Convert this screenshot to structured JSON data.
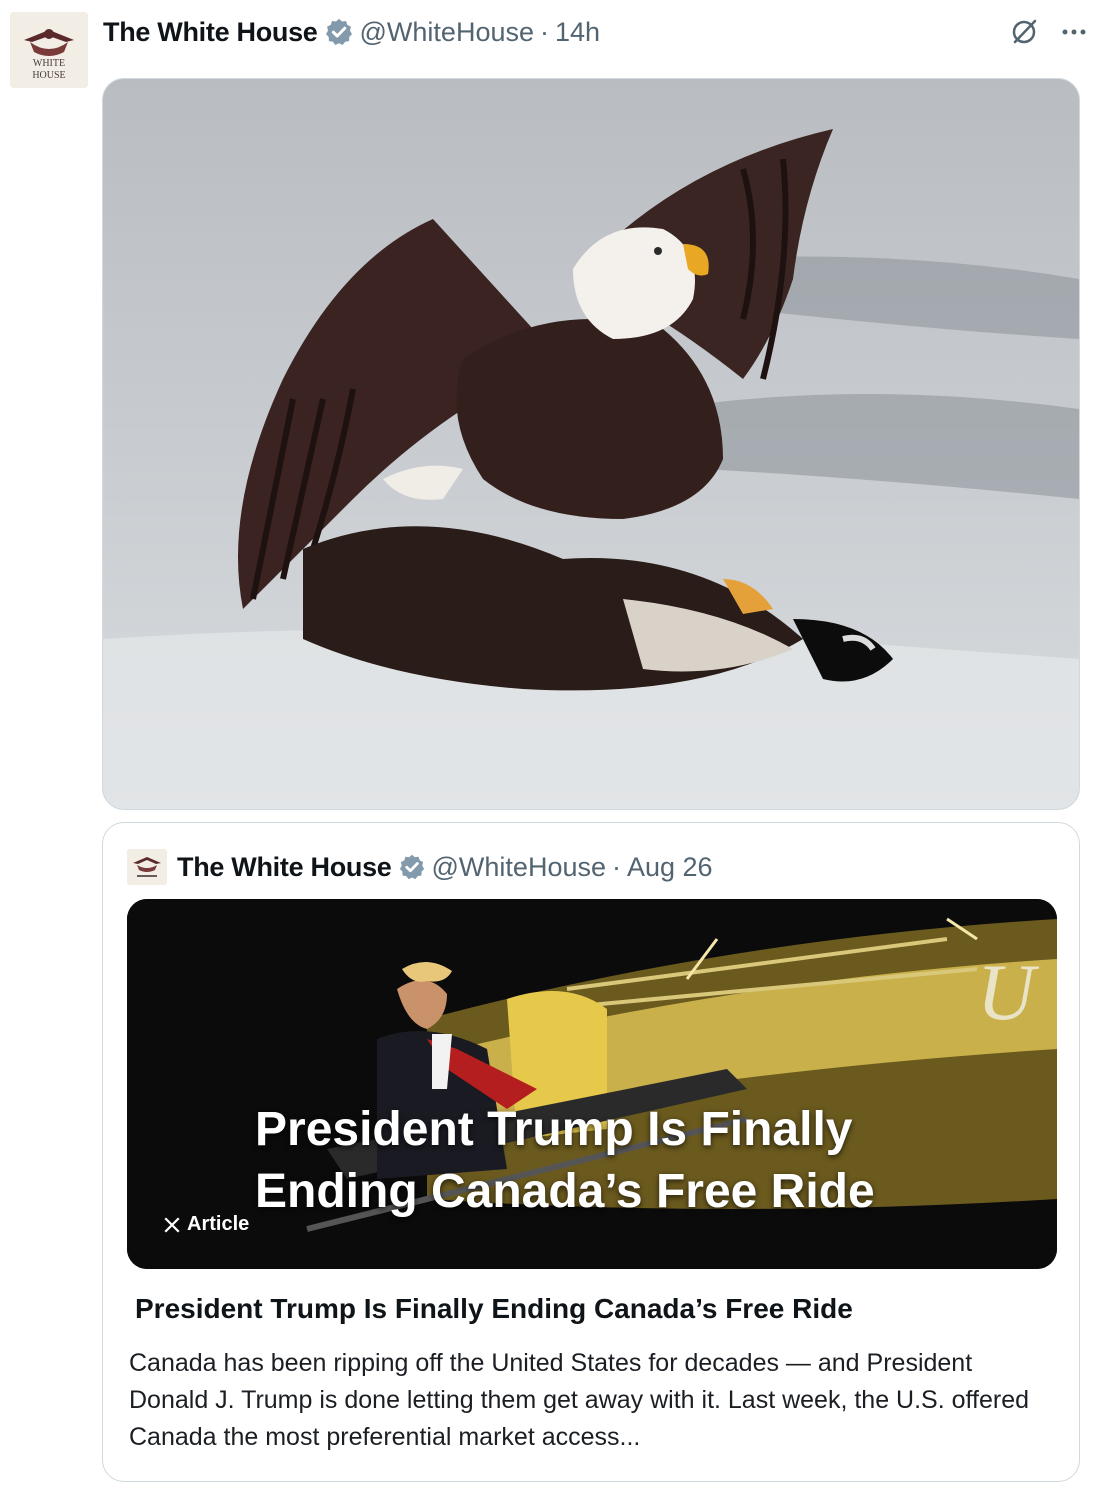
{
  "tweet": {
    "author_name": "The White House",
    "handle": "@WhiteHouse",
    "separator": "·",
    "time": "14h",
    "avatar_text": "WHITE HOUSE",
    "icons": {
      "verified": "verified-badge-icon",
      "grok": "grok-icon",
      "more": "more-icon"
    }
  },
  "quote": {
    "author_name": "The White House",
    "handle": "@WhiteHouse",
    "separator": "·",
    "date": "Aug 26",
    "article": {
      "overlay_title_line1": "President Trump Is Finally",
      "overlay_title_line2": "Ending Canada’s Free Ride",
      "badge": "Article",
      "title": "President Trump Is Finally Ending Canada’s Free Ride",
      "snippet": "Canada has been ripping off the United States for decades — and President Donald J. Trump is done letting them get away with it. Last week, the U.S. offered Canada the most preferential market access..."
    }
  },
  "colors": {
    "verified": "#1d9bf0",
    "secondary_text": "#536471",
    "border": "#cfd9de"
  }
}
